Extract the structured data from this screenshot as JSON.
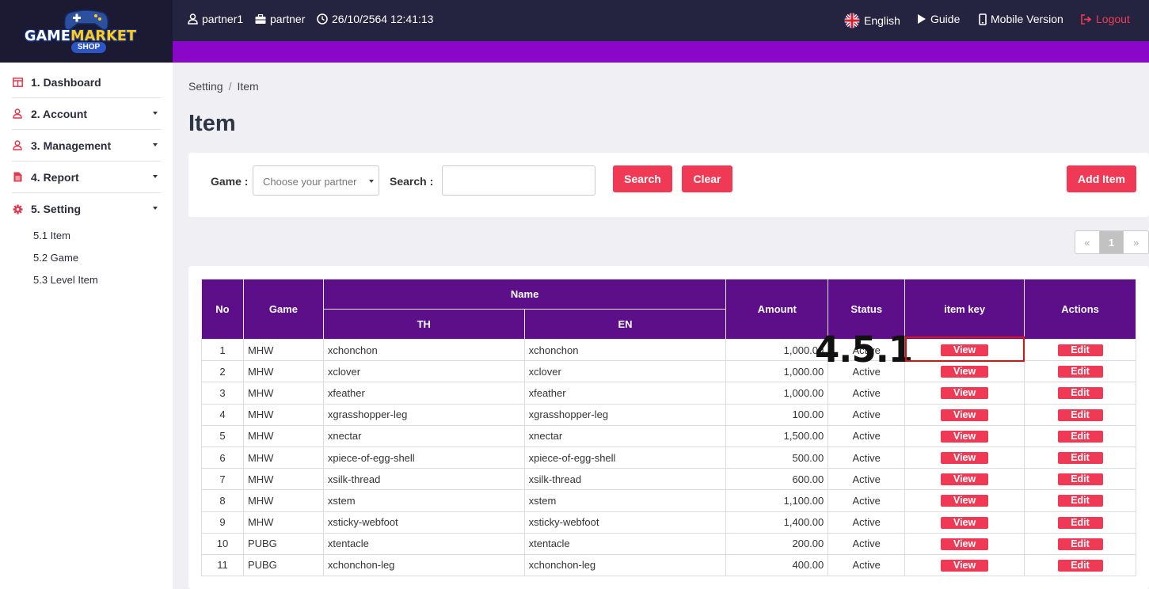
{
  "logo": {
    "word1": "GAME",
    "word2": "MARKET",
    "sub": "SHOP"
  },
  "topbar": {
    "username": "partner1",
    "role": "partner",
    "datetime": "26/10/2564 12:41:13",
    "language": "English",
    "guide": "Guide",
    "mobile": "Mobile Version",
    "logout": "Logout"
  },
  "sidebar": {
    "items": [
      {
        "label": "1. Dashboard",
        "icon": "dashboard-icon"
      },
      {
        "label": "2. Account",
        "icon": "user-icon"
      },
      {
        "label": "3. Management",
        "icon": "user-icon"
      },
      {
        "label": "4. Report",
        "icon": "report-icon"
      },
      {
        "label": "5. Setting",
        "icon": "gear-icon"
      }
    ],
    "sub_items": [
      "5.1 Item",
      "5.2 Game",
      "5.3 Level Item"
    ]
  },
  "breadcrumb": {
    "parent": "Setting",
    "separator": "/",
    "current": "Item"
  },
  "page_title": "Item",
  "filters": {
    "game_label": "Game :",
    "game_placeholder": "Choose your partner",
    "search_label": "Search :",
    "search_value": "",
    "search_button": "Search",
    "clear_button": "Clear",
    "add_button": "Add Item"
  },
  "pagination": {
    "prev": "«",
    "current": "1",
    "next": "»"
  },
  "table": {
    "headers": {
      "no": "No",
      "game": "Game",
      "name": "Name",
      "th": "TH",
      "en": "EN",
      "amount": "Amount",
      "status": "Status",
      "item_key": "item key",
      "actions": "Actions"
    },
    "view_label": "View",
    "edit_label": "Edit",
    "rows": [
      {
        "no": "1",
        "game": "MHW",
        "th": "xchonchon",
        "en": "xchonchon",
        "amount": "1,000.00",
        "status": "Active"
      },
      {
        "no": "2",
        "game": "MHW",
        "th": "xclover",
        "en": "xclover",
        "amount": "1,000.00",
        "status": "Active"
      },
      {
        "no": "3",
        "game": "MHW",
        "th": "xfeather",
        "en": "xfeather",
        "amount": "1,000.00",
        "status": "Active"
      },
      {
        "no": "4",
        "game": "MHW",
        "th": "xgrasshopper-leg",
        "en": "xgrasshopper-leg",
        "amount": "100.00",
        "status": "Active"
      },
      {
        "no": "5",
        "game": "MHW",
        "th": "xnectar",
        "en": "xnectar",
        "amount": "1,500.00",
        "status": "Active"
      },
      {
        "no": "6",
        "game": "MHW",
        "th": "xpiece-of-egg-shell",
        "en": "xpiece-of-egg-shell",
        "amount": "500.00",
        "status": "Active"
      },
      {
        "no": "7",
        "game": "MHW",
        "th": "xsilk-thread",
        "en": "xsilk-thread",
        "amount": "600.00",
        "status": "Active"
      },
      {
        "no": "8",
        "game": "MHW",
        "th": "xstem",
        "en": "xstem",
        "amount": "1,100.00",
        "status": "Active"
      },
      {
        "no": "9",
        "game": "MHW",
        "th": "xsticky-webfoot",
        "en": "xsticky-webfoot",
        "amount": "1,400.00",
        "status": "Active"
      },
      {
        "no": "10",
        "game": "PUBG",
        "th": "xtentacle",
        "en": "xtentacle",
        "amount": "200.00",
        "status": "Active"
      },
      {
        "no": "11",
        "game": "PUBG",
        "th": "xchonchon-leg",
        "en": "xchonchon-leg",
        "amount": "400.00",
        "status": "Active"
      }
    ]
  },
  "annotation": {
    "label": "4.5.1"
  },
  "colors": {
    "accent": "#f03a55",
    "header_purple": "#5c0f88",
    "bar_purple": "#8a07c9",
    "topbar": "#252440",
    "status_active": "#1a9a1a"
  }
}
